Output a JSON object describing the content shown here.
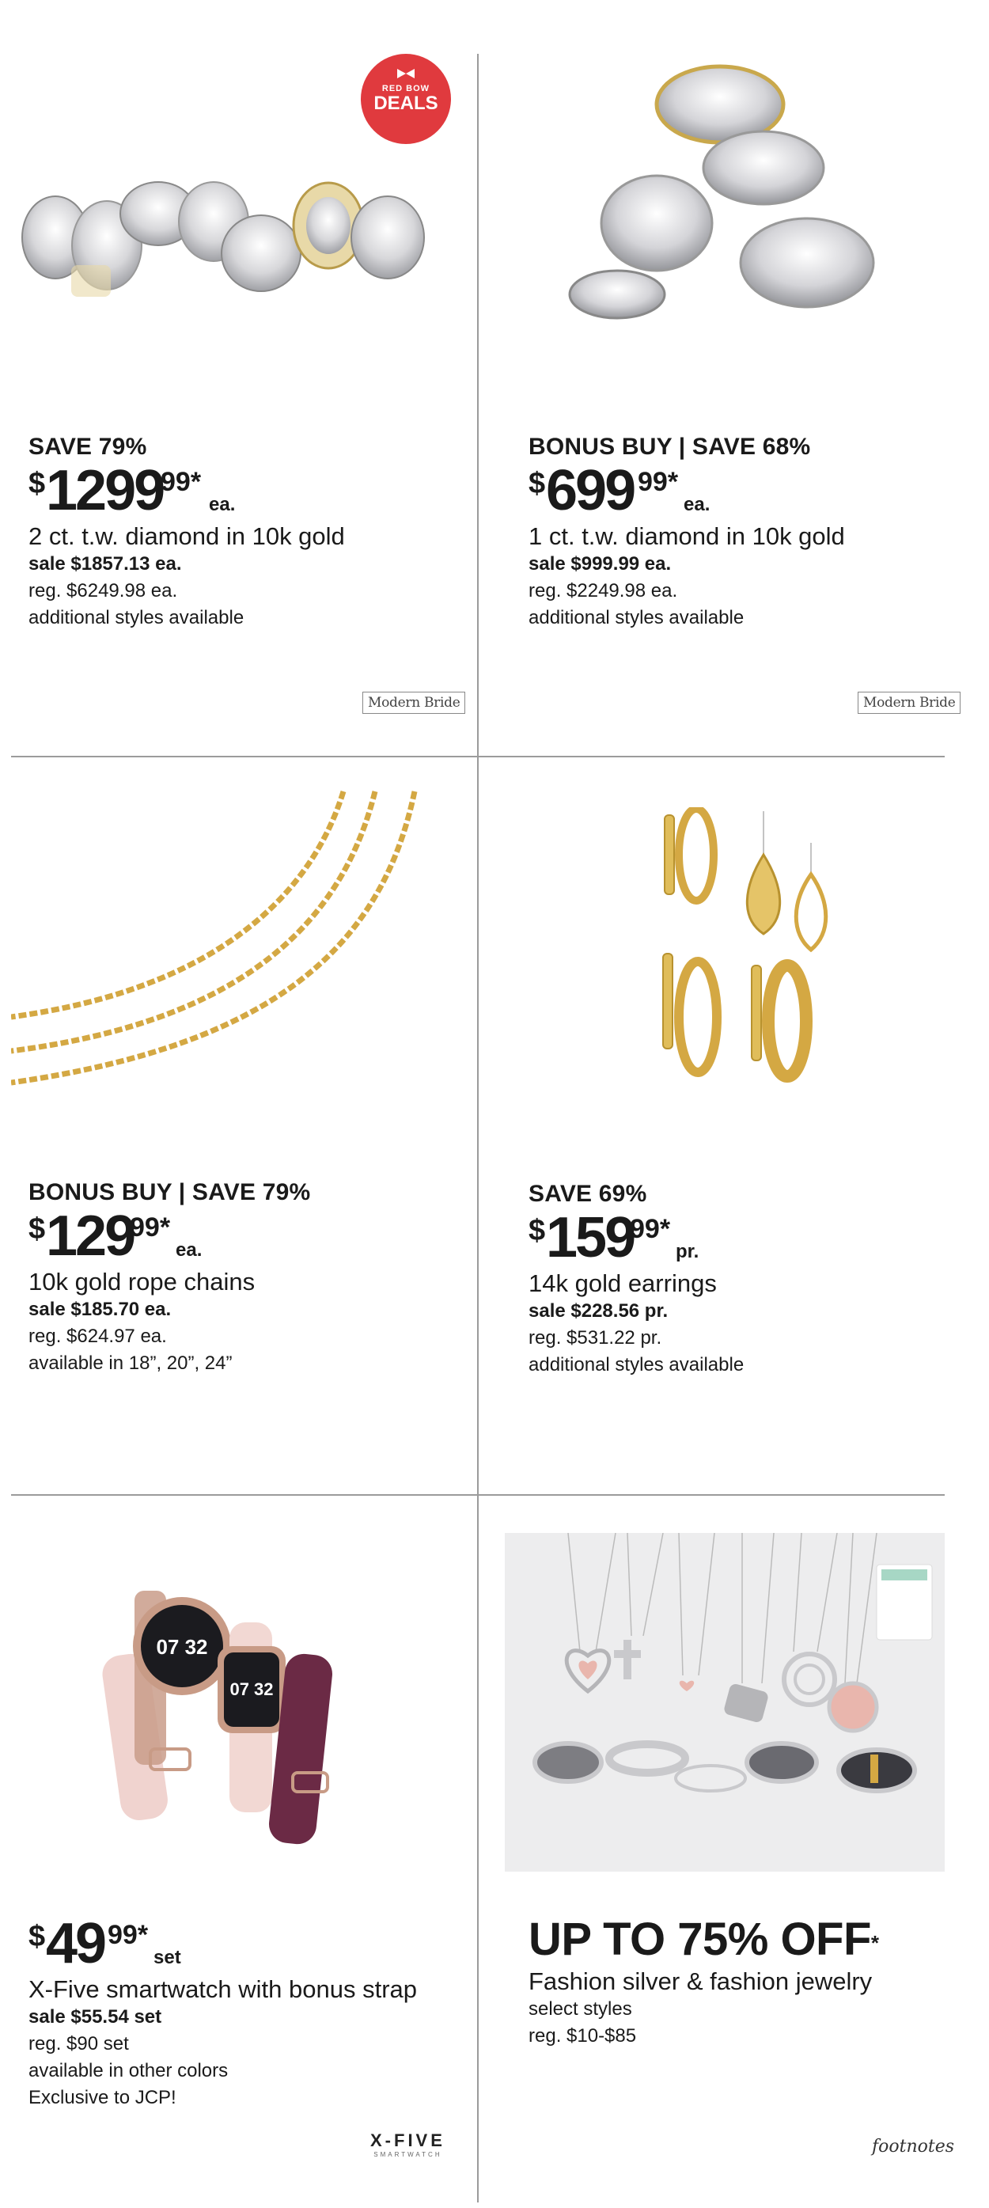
{
  "products": [
    {
      "headline": "SAVE 79%",
      "price": {
        "dollar": "$",
        "whole": "1299",
        "cents": "99*",
        "unit": "ea."
      },
      "description": "2 ct. t.w. diamond in 10k gold",
      "sale": "sale $1857.13 ea.",
      "regular": "reg. $6249.98 ea.",
      "note": "additional styles available",
      "brand": "Modern Bride",
      "badge": {
        "line1": "RED BOW",
        "line2": "DEALS"
      },
      "image_icon": "diamond-rings-image"
    },
    {
      "headline": "BONUS BUY | SAVE 68%",
      "price": {
        "dollar": "$",
        "whole": "699",
        "cents": "99*",
        "unit": "ea."
      },
      "description": "1 ct. t.w. diamond in 10k gold",
      "sale": "sale $999.99 ea.",
      "regular": "reg. $2249.98 ea.",
      "note": "additional styles available",
      "brand": "Modern Bride",
      "image_icon": "diamond-rings-image"
    },
    {
      "headline": "BONUS BUY | SAVE 79%",
      "price": {
        "dollar": "$",
        "whole": "129",
        "cents": "99*",
        "unit": "ea."
      },
      "description": "10k gold rope chains",
      "sale": "sale $185.70 ea.",
      "regular": "reg. $624.97 ea.",
      "note": "available in 18”, 20”, 24”",
      "image_icon": "gold-chains-image"
    },
    {
      "headline": "SAVE 69%",
      "price": {
        "dollar": "$",
        "whole": "159",
        "cents": "99*",
        "unit": "pr."
      },
      "description": "14k gold earrings",
      "sale": "sale $228.56 pr.",
      "regular": "reg.  $531.22 pr.",
      "note": "additional styles available",
      "image_icon": "gold-earrings-image"
    },
    {
      "price": {
        "dollar": "$",
        "whole": "49",
        "cents": "99*",
        "unit": "set"
      },
      "description": "X-Five smartwatch with bonus strap",
      "sale": "sale $55.54 set",
      "regular": "reg. $90 set",
      "note": "available in other colors",
      "note2": "Exclusive to JCP!",
      "brand": {
        "main": "X-FIVE",
        "sub": "SMARTWATCH"
      },
      "watch_time": "07 32",
      "image_icon": "smartwatch-image"
    },
    {
      "headline": "UP TO 75% OFF",
      "headline_mark": "*",
      "description": "Fashion silver & fashion jewelry",
      "note": "select styles",
      "regular": "reg. $10-$85",
      "brand": "footnotes",
      "image_icon": "silver-jewelry-image"
    }
  ],
  "colors": {
    "badge_red": "#e03a3e",
    "divider": "#9b9b9b",
    "gold": "#d4a843",
    "silver": "#c9c9cc"
  }
}
